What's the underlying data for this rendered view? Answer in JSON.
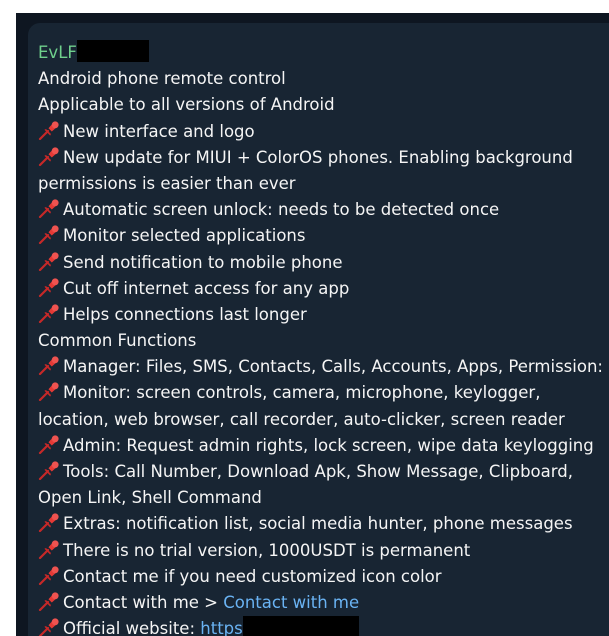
{
  "message": {
    "sender": "EvLF",
    "lines": [
      {
        "text": "Android phone remote control",
        "pin": false
      },
      {
        "text": "Applicable to all versions of Android",
        "pin": false
      },
      {
        "text": "New interface and logo",
        "pin": true
      },
      {
        "text": "New update for MIUI + ColorOS phones. Enabling background",
        "pin": true
      },
      {
        "text": "permissions is easier than ever",
        "pin": false
      },
      {
        "text": "Automatic screen unlock: needs to be detected once",
        "pin": true
      },
      {
        "text": "Monitor selected applications",
        "pin": true
      },
      {
        "text": "Send notification to mobile phone",
        "pin": true
      },
      {
        "text": "Cut off internet access for any app",
        "pin": true
      },
      {
        "text": "Helps connections last longer",
        "pin": true
      },
      {
        "text": "Common Functions",
        "pin": false
      },
      {
        "text": "Manager: Files, SMS, Contacts, Calls, Accounts, Apps, Permission:",
        "pin": true
      },
      {
        "text": "Monitor: screen controls, camera, microphone, keylogger,",
        "pin": true
      },
      {
        "text": "location, web browser, call recorder, auto-clicker, screen reader",
        "pin": false
      },
      {
        "text": "Admin: Request admin rights, lock screen, wipe data  keylogging",
        "pin": true
      },
      {
        "text": "Tools: Call Number, Download Apk, Show Message, Clipboard,",
        "pin": true
      },
      {
        "text": "Open Link, Shell Command",
        "pin": false
      },
      {
        "text": "Extras: notification list, social media hunter, phone messages",
        "pin": true
      },
      {
        "text": "There is no trial version, 1000USDT is permanent",
        "pin": true
      },
      {
        "text": "Contact me if you need customized icon color",
        "pin": true
      }
    ],
    "contact_prefix": "Contact with me > ",
    "contact_link": "Contact with me",
    "website_prefix": "Official website: ",
    "website_link": "https"
  },
  "colors": {
    "background": "#0e1621",
    "bubble": "#182533",
    "text": "#f5f5f5",
    "sender": "#6fd08c",
    "link": "#6ab3f3",
    "pin": "#e53935"
  },
  "icons": {
    "pin": "pushpin-icon"
  }
}
